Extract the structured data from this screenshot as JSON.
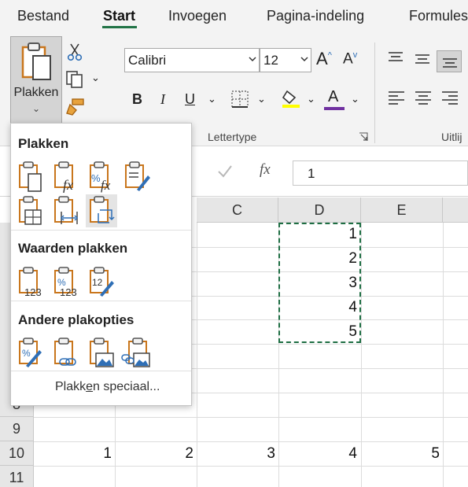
{
  "ribbon": {
    "tabs": [
      {
        "label": "Bestand",
        "active": false
      },
      {
        "label": "Start",
        "active": true
      },
      {
        "label": "Invoegen",
        "active": false
      },
      {
        "label": "Pagina-indeling",
        "active": false
      },
      {
        "label": "Formules",
        "active": false
      }
    ],
    "paste_label": "Plakken",
    "font_name": "Calibri",
    "font_size": "12",
    "bold_label": "B",
    "italic_label": "I",
    "underline_label": "U",
    "font_group_label": "Lettertype",
    "align_group_label": "Uitlij",
    "grow_font": "A",
    "shrink_font": "A",
    "font_color_letter": "A",
    "accent_color": "#217346",
    "font_color_bar": "#7030a0"
  },
  "formula_bar": {
    "fx_symbol": "fx",
    "value": "1"
  },
  "grid": {
    "columns": [
      "C",
      "D",
      "E"
    ],
    "rows": [
      "8",
      "9",
      "10",
      "11"
    ],
    "row10_values": [
      "1",
      "2",
      "3",
      "4",
      "5"
    ],
    "column_d_values": [
      "1",
      "2",
      "3",
      "4",
      "5"
    ]
  },
  "paste_menu": {
    "section_paste": "Plakken",
    "section_values": "Waarden plakken",
    "section_other": "Andere plakopties",
    "special_prefix": "Plakk",
    "special_underlined": "e",
    "special_suffix": "n speciaal...",
    "icons_paste": [
      "paste-icon",
      "paste-formulas-icon",
      "paste-formulas-number-format-icon",
      "keep-source-formatting-icon",
      "no-borders-icon",
      "keep-column-widths-icon",
      "transpose-icon"
    ],
    "icons_values": [
      "paste-values-icon",
      "values-number-format-icon",
      "values-source-formatting-icon"
    ],
    "icons_other": [
      "formatting-icon",
      "paste-link-icon",
      "picture-icon",
      "linked-picture-icon"
    ]
  }
}
